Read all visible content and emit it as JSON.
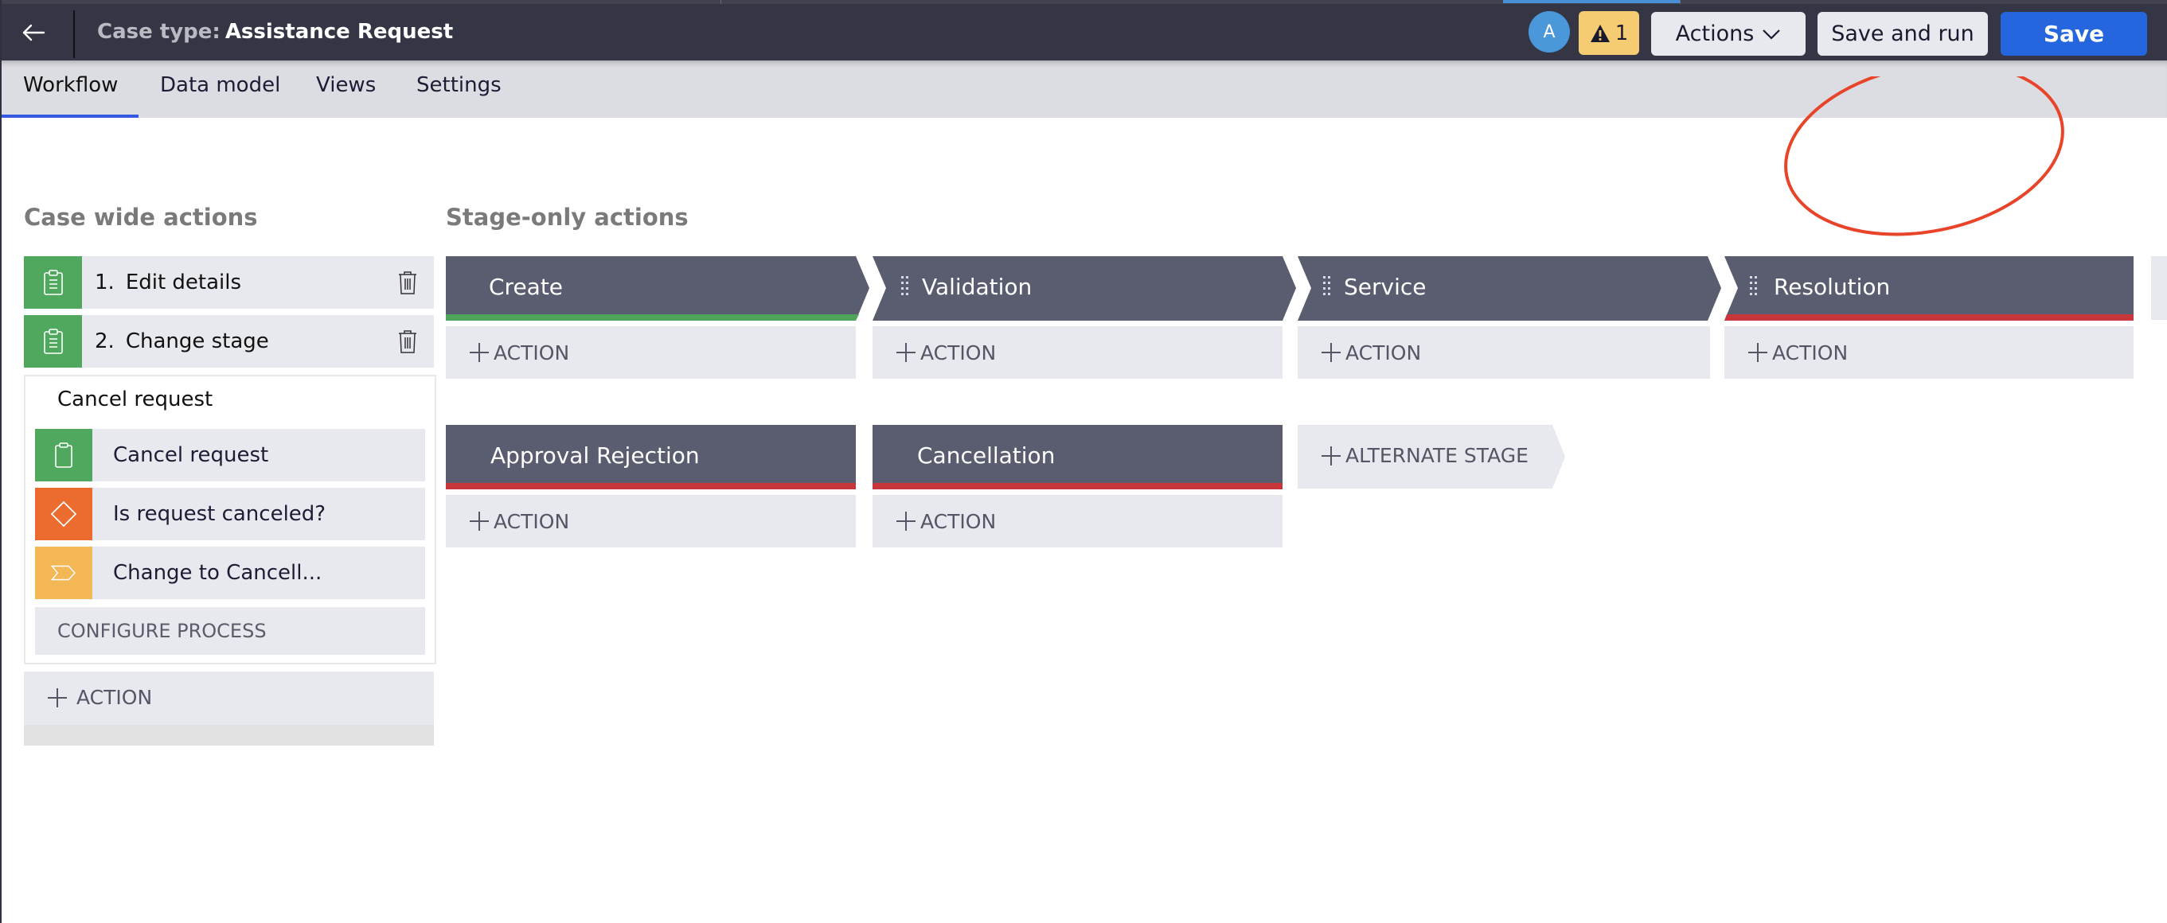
{
  "header": {
    "back_icon": "arrow-left-icon",
    "case_type_label": "Case type:",
    "case_type_value": "Assistance Request",
    "avatar_initial": "A",
    "warning_icon": "warning-triangle-icon",
    "warning_count": "1",
    "actions_label": "Actions",
    "save_and_run_label": "Save and run",
    "save_label": "Save"
  },
  "tabs": [
    {
      "label": "Workflow",
      "active": true
    },
    {
      "label": "Data model",
      "active": false
    },
    {
      "label": "Views",
      "active": false
    },
    {
      "label": "Settings",
      "active": false
    }
  ],
  "case_wide": {
    "title": "Case wide actions",
    "items": [
      {
        "number": "1.",
        "label": "Edit details",
        "icon": "clipboard-list-icon"
      },
      {
        "number": "2.",
        "label": "Change stage",
        "icon": "clipboard-list-icon"
      }
    ],
    "process": {
      "title": "Cancel request",
      "steps": [
        {
          "label": "Cancel request",
          "icon": "clipboard-icon",
          "color": "#50a75e"
        },
        {
          "label": "Is request canceled?",
          "icon": "decision-diamond-icon",
          "color": "#ec6b2f"
        },
        {
          "label": "Change to Cancell...",
          "icon": "change-stage-chevron-icon",
          "color": "#f3b755"
        }
      ],
      "configure_label": "CONFIGURE PROCESS"
    },
    "add_action_label": "ACTION"
  },
  "stage_only": {
    "title": "Stage-only actions",
    "primary_stages": [
      {
        "name": "Create",
        "status_color": "#4fa45c",
        "action_label": "ACTION"
      },
      {
        "name": "Validation",
        "status_color": null,
        "action_label": "ACTION"
      },
      {
        "name": "Service",
        "status_color": null,
        "action_label": "ACTION"
      },
      {
        "name": "Resolution",
        "status_color": "#c8353a",
        "action_label": "ACTION"
      }
    ],
    "alternate_stages": [
      {
        "name": "Approval Rejection",
        "status_color": "#c8353a",
        "action_label": "ACTION"
      },
      {
        "name": "Cancellation",
        "status_color": "#c8353a",
        "action_label": "ACTION"
      }
    ],
    "add_alternate_label": "ALTERNATE STAGE"
  },
  "colors": {
    "stage_bg": "#5a5c70",
    "primary_blue": "#2565de",
    "annotation": "#e8442a"
  }
}
